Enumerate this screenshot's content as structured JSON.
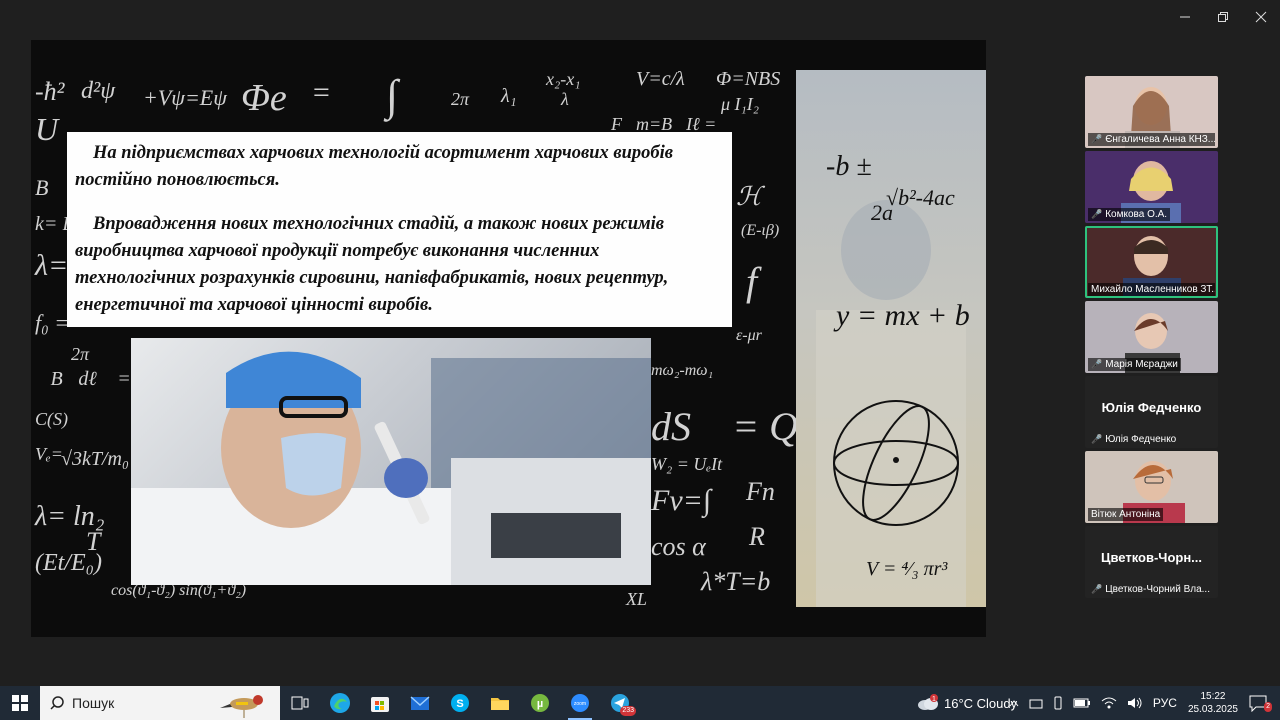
{
  "slide": {
    "paragraph1": "На підприємствах харчових технологій  асортимент харчових виробів постійно поновлюється.",
    "paragraph2": "Впровадження нових технологічних стадій, а також нових режимів виробництва харчової продукції потребує  виконання численних технологічних розрахунків сировини, напівфабрикатів, нових рецептур, енергетичної та харчової цінності виробів.",
    "side_formulas": {
      "quadratic": "-b ± √b²-4ac / 2a",
      "line": "y = mx + b",
      "sphere": "V = 4/3 πr³"
    }
  },
  "participants": [
    {
      "caption": "Єнгаличева Анна КНЗ...",
      "muted": true,
      "video": true,
      "active": false,
      "bg": "#d8c7c2"
    },
    {
      "caption": "Комкова О.А.",
      "muted": true,
      "video": true,
      "active": false,
      "bg": "#3a2a5a"
    },
    {
      "caption": "Михайло Масленников ЗТ...",
      "muted": false,
      "video": true,
      "active": true,
      "bg": "#5a3434"
    },
    {
      "caption": "Марія Мєраджи",
      "muted": true,
      "video": true,
      "active": false,
      "bg": "#b7b2ba"
    },
    {
      "caption": "Юлія Федченко",
      "name": "Юлія Федченко",
      "muted": true,
      "video": false,
      "active": false,
      "bg": "#232323"
    },
    {
      "caption": "Вітюк Антоніна",
      "muted": false,
      "video": true,
      "active": false,
      "bg": "#cfc4bb"
    },
    {
      "caption": "Цветков-Чорний Вла...",
      "name": "Цветков-Чорн...",
      "muted": true,
      "video": false,
      "active": false,
      "bg": "#232323"
    }
  ],
  "taskbar": {
    "search_placeholder": "Пошук",
    "apps": [
      "task-view",
      "edge",
      "store",
      "mail",
      "skype",
      "explorer",
      "utorrent",
      "zoom",
      "telegram"
    ],
    "telegram_badge": "233",
    "weather_alert": "1",
    "weather": "16°C  Cloudy",
    "language": "РУС",
    "time": "15:22",
    "date": "25.03.2025",
    "notifications": "2"
  },
  "colors": {
    "active_speaker": "#2ec27e",
    "taskbar": "#202a36",
    "muted": "#e04a4a"
  }
}
